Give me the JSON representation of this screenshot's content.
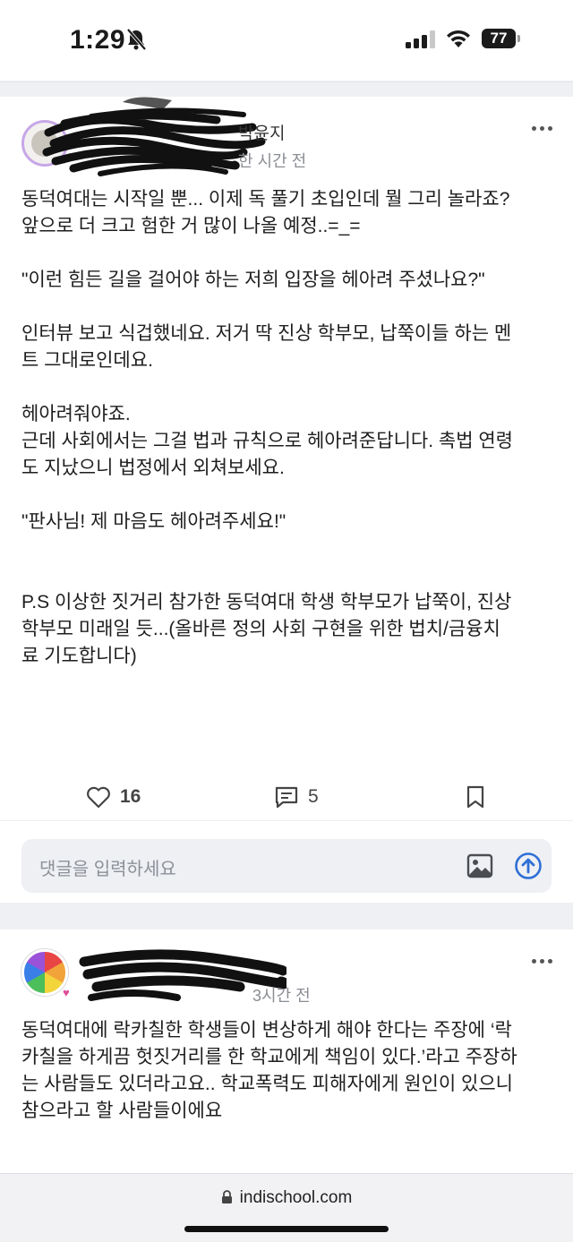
{
  "status_bar": {
    "time": "1:29",
    "battery": "77"
  },
  "post1": {
    "author_visible": "박윤지",
    "time": "한 시간 전",
    "lines": [
      "동덕여대는 시작일 뿐... 이제 독 풀기 초입인데 뭘 그리 놀라죠?",
      "앞으로 더 크고 험한 거 많이 나올 예정..=_=",
      "\"이런 힘든 길을 걸어야 하는 저희 입장을 헤아려 주셨나요?\"",
      "인터뷰 보고 식겁했네요. 저거 딱 진상 학부모, 납쭉이들 하는 멘",
      "트 그대로인데요.",
      "헤아려줘야죠.",
      "근데 사회에서는 그걸 법과 규칙으로 헤아려준답니다. 촉법 연령",
      "도 지났으니 법정에서 외쳐보세요.",
      "\"판사님! 제 마음도 헤아려주세요!\"",
      "P.S 이상한 짓거리 참가한 동덕여대 학생 학부모가 납쭉이, 진상",
      "학부모 미래일 듯...(올바른 정의 사회 구현을 위한 법치/금융치",
      "료 기도합니다)"
    ],
    "likes": "16",
    "comments": "5"
  },
  "comment_box": {
    "placeholder": "댓글을 입력하세요"
  },
  "post2": {
    "time": "3시간 전",
    "lines": [
      "동덕여대에 락카칠한 학생들이 변상하게 해야 한다는 주장에 ‘락",
      "카칠을 하게끔 헛짓거리를 한 학교에게 책임이 있다.’라고 주장하",
      "는 사람들도 있더라고요.. 학교폭력도 피해자에게 원인이 있으니",
      "참으라고 할 사람들이에요"
    ]
  },
  "browser": {
    "url": "indischool.com"
  }
}
